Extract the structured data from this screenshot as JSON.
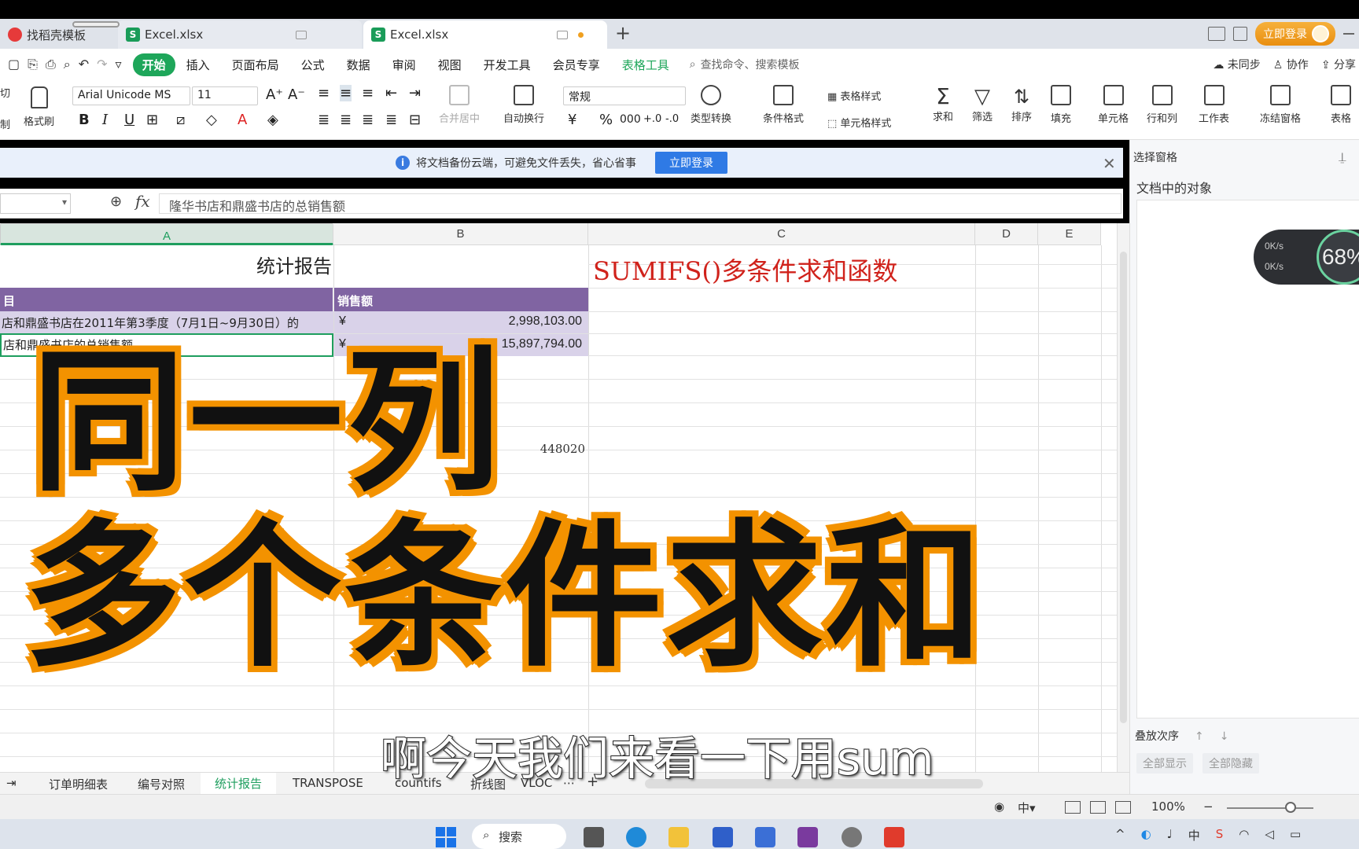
{
  "tabs": [
    {
      "label": "找稻壳模板"
    },
    {
      "label": "Excel.xlsx"
    },
    {
      "label": "Excel.xlsx"
    }
  ],
  "tabbar": {
    "login_label": "立即登录",
    "new_tab": "+"
  },
  "menubar": {
    "items": [
      "开始",
      "插入",
      "页面布局",
      "公式",
      "数据",
      "审阅",
      "视图",
      "开发工具",
      "会员专享",
      "表格工具"
    ],
    "search_placeholder": "查找命令、搜索模板",
    "right": [
      "未同步",
      "协作",
      "分享"
    ]
  },
  "ribbon": {
    "cut": "切",
    "cut2": "制",
    "format_painter": "格式刷",
    "font_name": "Arial Unicode MS",
    "font_size": "11",
    "merge_center": "合并居中",
    "wrap_text": "自动换行",
    "number_format": "常规",
    "type_convert": "类型转换",
    "conditional_format": "条件格式",
    "table_style": "表格样式",
    "cell_style": "单元格样式",
    "sum": "求和",
    "filter": "筛选",
    "sort": "排序",
    "fill": "填充",
    "cells": "单元格",
    "rows_cols": "行和列",
    "worksheet": "工作表",
    "freeze": "冻结窗格",
    "table_tools": "表格",
    "currency_symbol": "¥",
    "percent_symbol": "%"
  },
  "notice": {
    "text": "将文档备份云端，可避免文件丢失，省心省事",
    "button": "立即登录"
  },
  "formula_bar": {
    "content": "隆华书店和鼎盛书店的总销售额"
  },
  "columns": [
    "A",
    "B",
    "C",
    "D",
    "E"
  ],
  "sheet": {
    "title": "统计报告",
    "header_item": "目",
    "header_sales": "销售额",
    "row1_item": "店和鼎盛书店在2011年第3季度（7月1日~9月30日）的",
    "row1_cur": "¥",
    "row1_value": "2,998,103.00",
    "row2_item": "店和鼎盛书店的总销售额",
    "row2_cur": "¥",
    "row2_value": "15,897,794.00",
    "sumifs_label": "SUMIFS()多条件求和函数",
    "loose_number": "448020"
  },
  "sheet_tabs": [
    "订单明细表",
    "编号对照",
    "统计报告",
    "TRANSPOSE",
    "countifs",
    "折线图",
    "VLOC"
  ],
  "statusbar": {
    "zoom": "100%"
  },
  "side_pane": {
    "header": "选择窗格",
    "title": "文档中的对象",
    "order_label": "叠放次序",
    "show_all": "全部显示",
    "hide_all": "全部隐藏"
  },
  "net_widget": {
    "up": "0K/s",
    "down": "0K/s",
    "percent": "68%"
  },
  "taskbar": {
    "search": "搜索"
  },
  "overlay": {
    "line1": "同一列",
    "line2": "多个条件求和",
    "subtitle": "啊今天我们来看一下用sum"
  },
  "colors": {
    "accent_green": "#1ea65a",
    "header_purple": "#8064a2",
    "row_lavender": "#d9d2e9",
    "sumifs_red": "#d0221b",
    "overlay_orange": "#f39200"
  }
}
